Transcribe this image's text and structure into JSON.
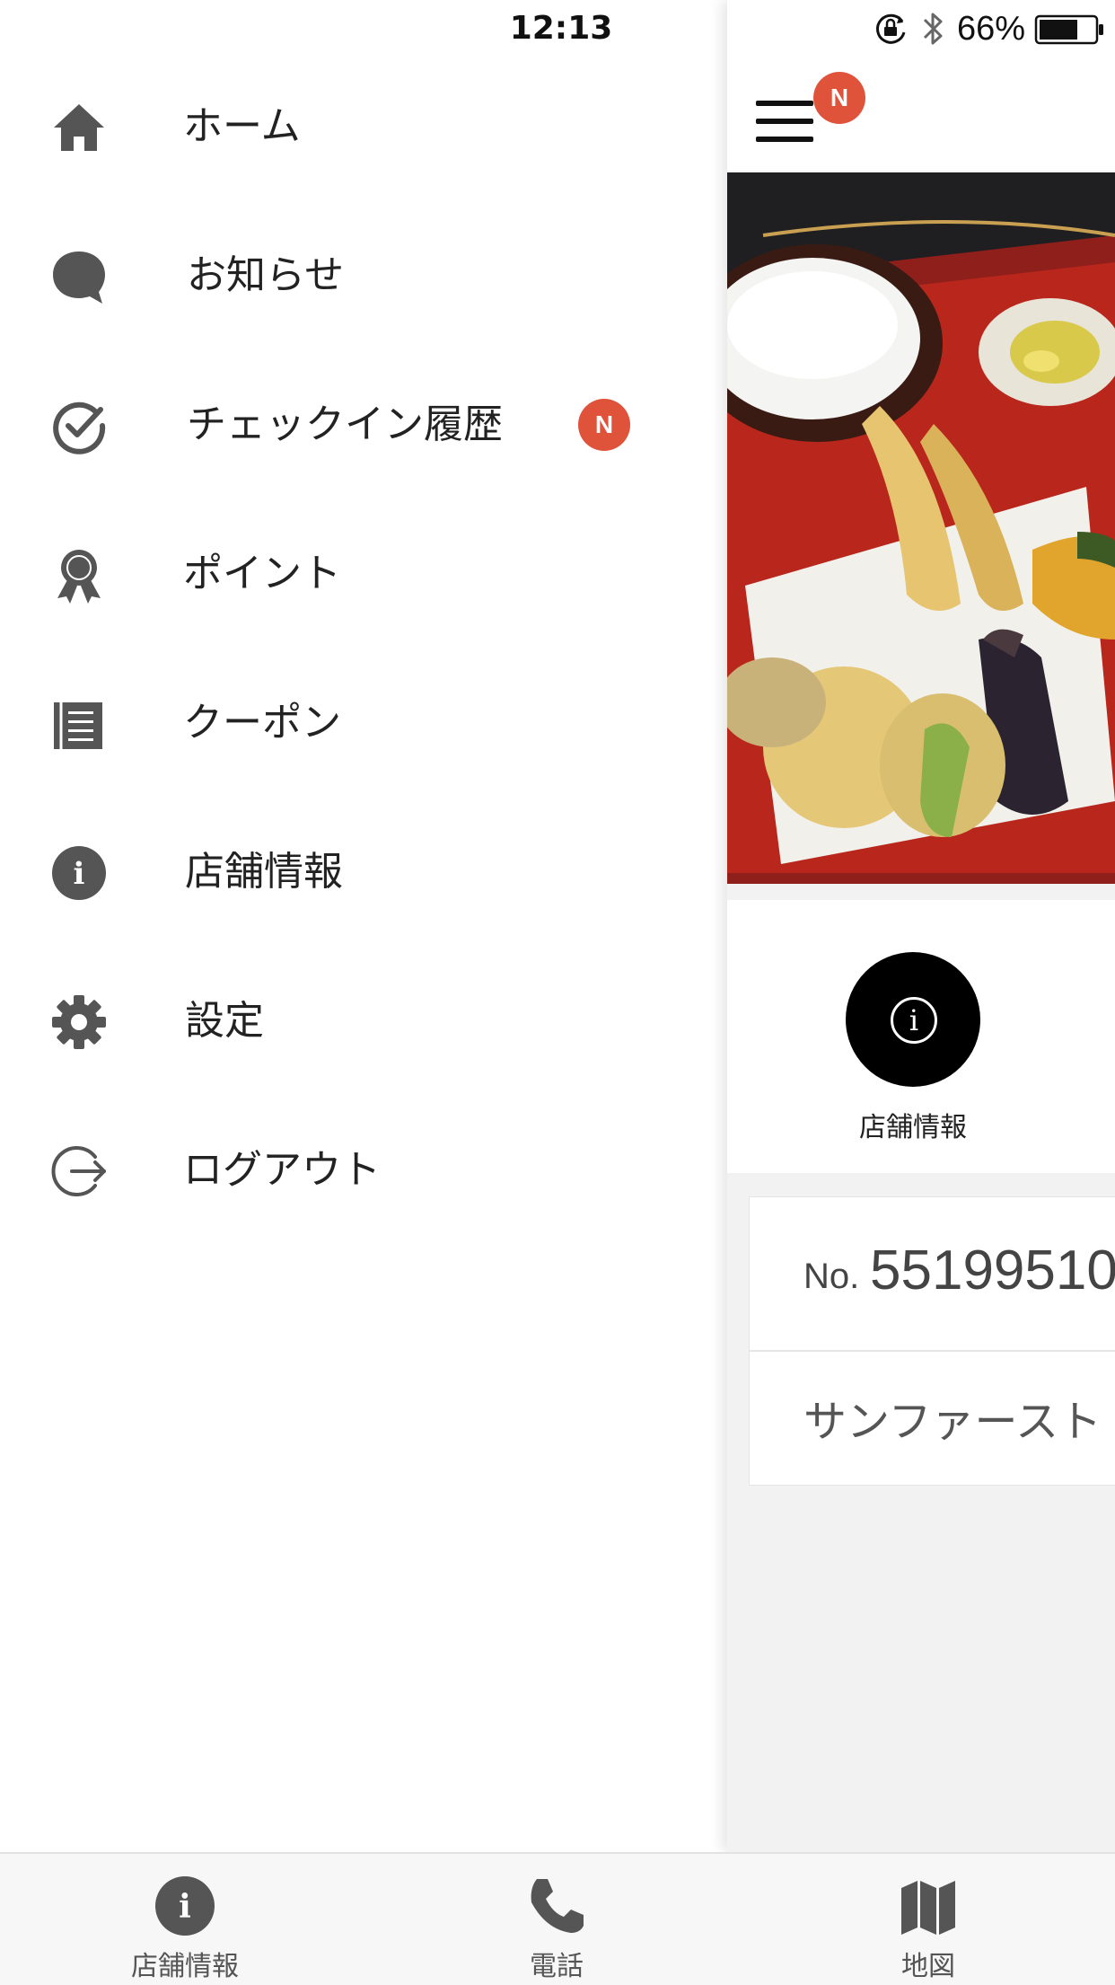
{
  "status_bar": {
    "time": "12:13",
    "battery": "66%"
  },
  "drawer": {
    "items": [
      {
        "label": "ホーム",
        "icon": "home-icon"
      },
      {
        "label": "お知らせ",
        "icon": "speech-bubble-icon"
      },
      {
        "label": "チェックイン履歴",
        "icon": "check-circle-icon",
        "badge": "N"
      },
      {
        "label": "ポイント",
        "icon": "award-ribbon-icon"
      },
      {
        "label": "クーポン",
        "icon": "coupon-list-icon"
      },
      {
        "label": "店舗情報",
        "icon": "info-icon"
      },
      {
        "label": "設定",
        "icon": "gear-icon"
      },
      {
        "label": "ログアウト",
        "icon": "logout-icon"
      }
    ]
  },
  "main": {
    "menu_badge": "N",
    "info_button_label": "店舗情報",
    "member_card": {
      "number_prefix": "No.",
      "number": "55199510",
      "shop_name": "サンファースト"
    }
  },
  "bottom_tabs": [
    {
      "label": "店舗情報",
      "icon": "info-icon"
    },
    {
      "label": "電話",
      "icon": "phone-icon"
    },
    {
      "label": "地図",
      "icon": "map-icon"
    }
  ],
  "colors": {
    "badge": "#e0533b",
    "icon_gray": "#555555",
    "text": "#222222"
  }
}
